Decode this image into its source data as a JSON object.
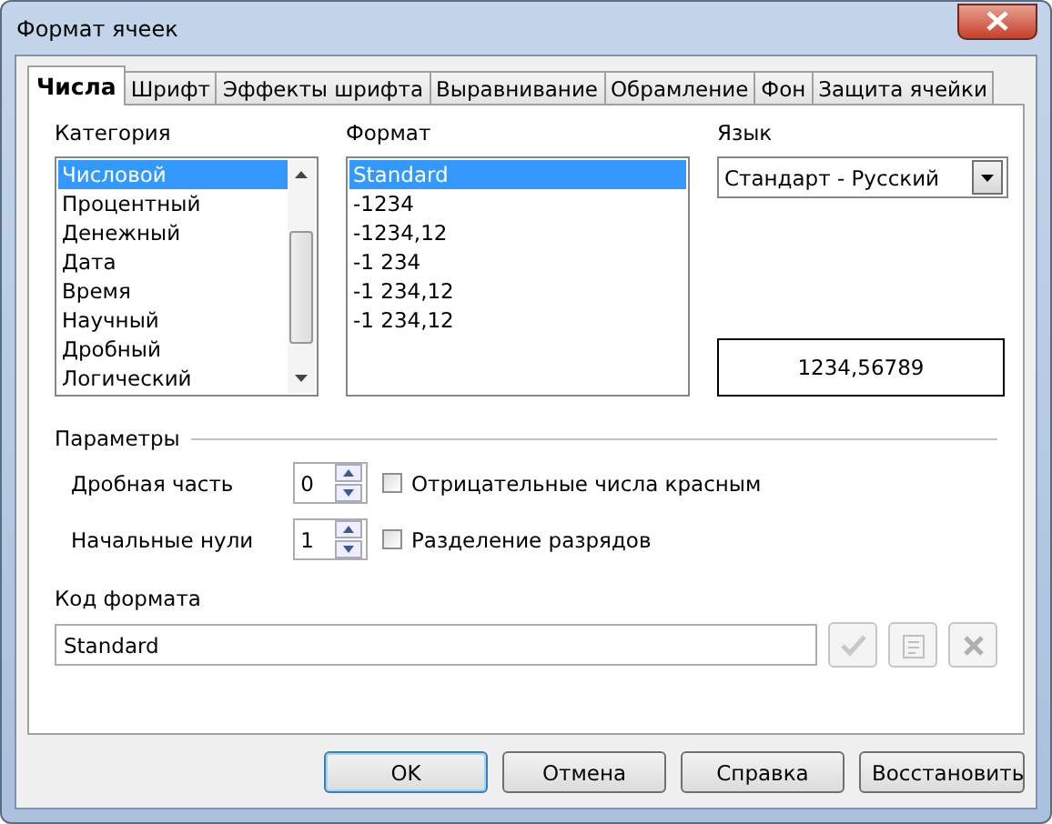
{
  "window": {
    "title": "Формат ячеек"
  },
  "tabs": [
    {
      "label": "Числа",
      "selected": true
    },
    {
      "label": "Шрифт",
      "selected": false
    },
    {
      "label": "Эффекты шрифта",
      "selected": false
    },
    {
      "label": "Выравнивание",
      "selected": false
    },
    {
      "label": "Обрамление",
      "selected": false
    },
    {
      "label": "Фон",
      "selected": false
    },
    {
      "label": "Защита ячейки",
      "selected": false
    }
  ],
  "category": {
    "label": "Категория",
    "items": [
      {
        "label": "Числовой",
        "selected": true
      },
      {
        "label": "Процентный",
        "selected": false
      },
      {
        "label": "Денежный",
        "selected": false
      },
      {
        "label": "Дата",
        "selected": false
      },
      {
        "label": "Время",
        "selected": false
      },
      {
        "label": "Научный",
        "selected": false
      },
      {
        "label": "Дробный",
        "selected": false
      },
      {
        "label": "Логический",
        "selected": false
      }
    ]
  },
  "format": {
    "label": "Формат",
    "items": [
      {
        "label": "Standard",
        "selected": true
      },
      {
        "label": "-1234",
        "selected": false
      },
      {
        "label": "-1234,12",
        "selected": false
      },
      {
        "label": "-1 234",
        "selected": false
      },
      {
        "label": "-1 234,12",
        "selected": false
      },
      {
        "label": "-1 234,12",
        "selected": false
      }
    ]
  },
  "language": {
    "label": "Язык",
    "value": "Стандарт - Русский"
  },
  "preview": "1234,56789",
  "parameters": {
    "title": "Параметры",
    "spinners": [
      {
        "label": "Дробная часть",
        "value": "0"
      },
      {
        "label": "Начальные нули",
        "value": "1"
      }
    ],
    "checkboxes": [
      {
        "label": "Отрицательные числа красным",
        "checked": false
      },
      {
        "label": "Разделение разрядов",
        "checked": false
      }
    ]
  },
  "format_code": {
    "label": "Код формата",
    "value": "Standard"
  },
  "buttons": [
    {
      "label": "OK",
      "default": true
    },
    {
      "label": "Отмена",
      "default": false
    },
    {
      "label": "Справка",
      "default": false
    },
    {
      "label": "Восстановить",
      "default": false
    }
  ]
}
